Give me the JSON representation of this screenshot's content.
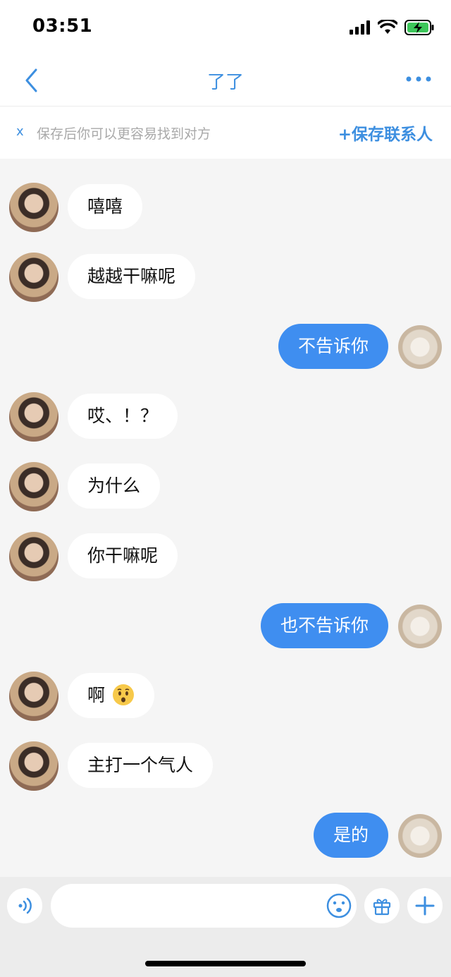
{
  "status_bar": {
    "time": "03:51"
  },
  "nav": {
    "title": "了了"
  },
  "save_banner": {
    "close": "x",
    "hint": "保存后你可以更容易找到对方",
    "action": "+保存联系人"
  },
  "messages": [
    {
      "side": "left",
      "text": "嘻嘻"
    },
    {
      "side": "left",
      "text": "越越干嘛呢"
    },
    {
      "side": "right",
      "text": "不告诉你"
    },
    {
      "side": "left",
      "text": "哎、！？"
    },
    {
      "side": "left",
      "text": "为什么"
    },
    {
      "side": "left",
      "text": "你干嘛呢"
    },
    {
      "side": "right",
      "text": "也不告诉你"
    },
    {
      "side": "left",
      "text": "啊",
      "emoji": "hushed-face-emoji"
    },
    {
      "side": "left",
      "text": "主打一个气人"
    },
    {
      "side": "right",
      "text": "是的"
    }
  ],
  "input_bar": {
    "placeholder": ""
  },
  "colors": {
    "accent": "#3d8fe0",
    "outgoing_bubble": "#3f8ef0",
    "background": "#f5f5f5"
  }
}
